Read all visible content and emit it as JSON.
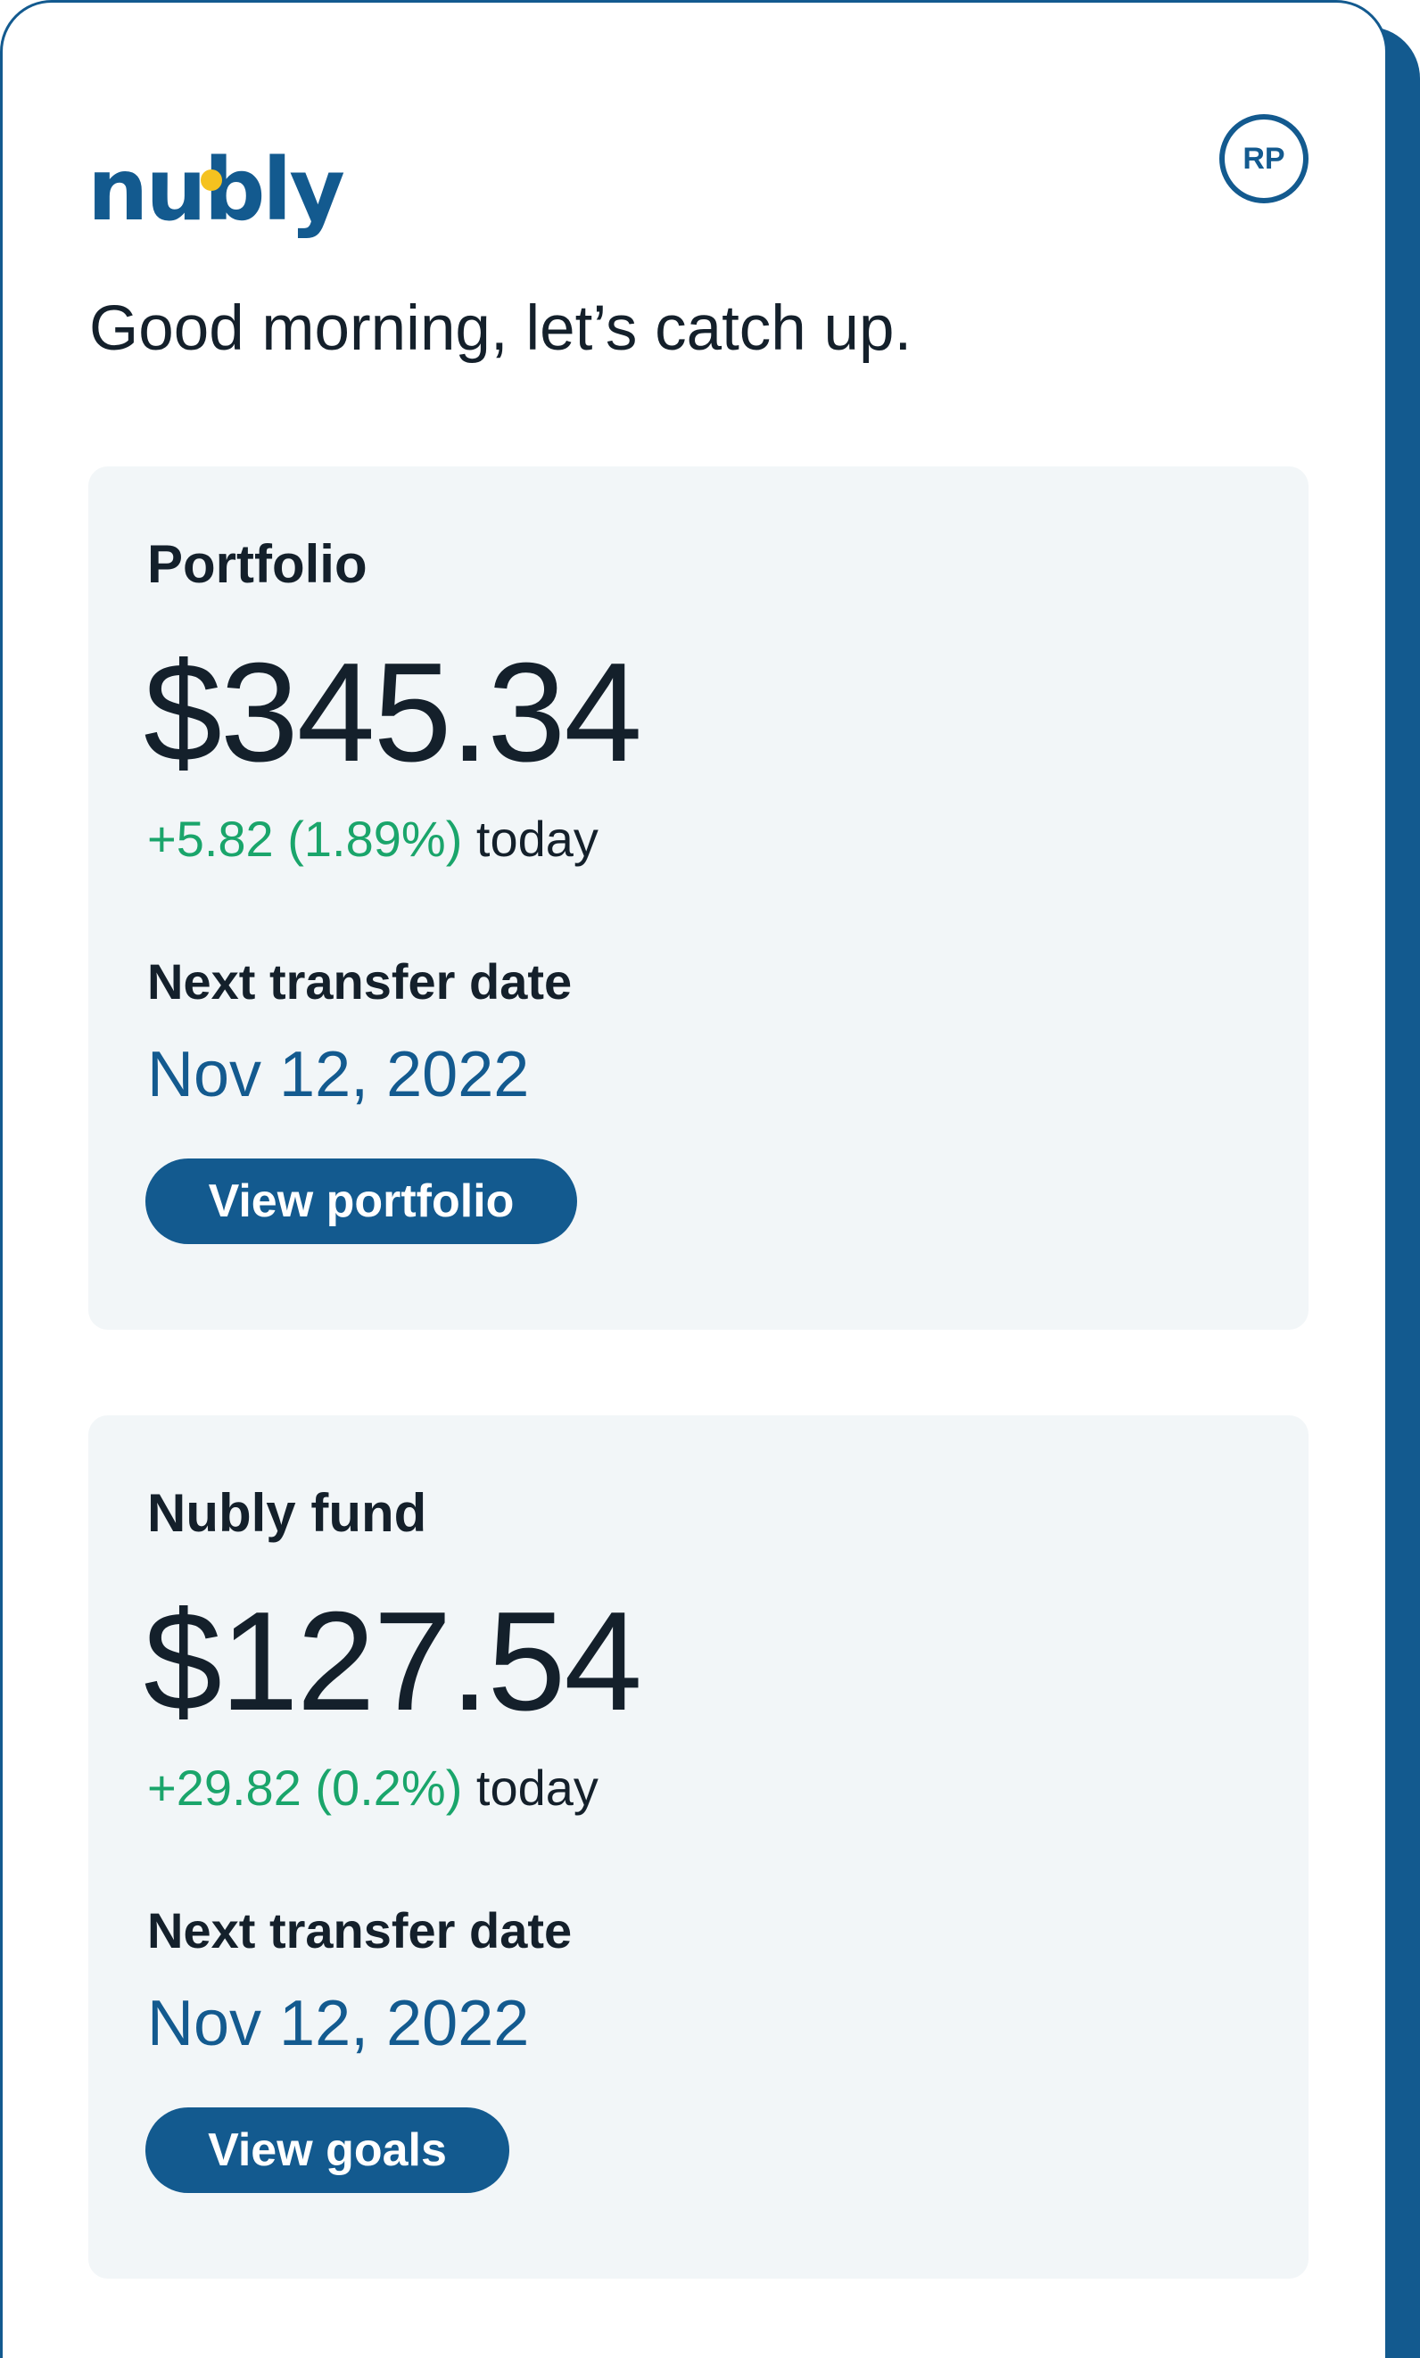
{
  "header": {
    "logo_text": "nubly",
    "avatar_initials": "RP"
  },
  "greeting": "Good morning, let’s catch up.",
  "cards": [
    {
      "title": "Portfolio",
      "amount": "$345.34",
      "change": "+5.82 (1.89%)",
      "change_suffix": "today",
      "transfer_label": "Next transfer date",
      "transfer_date": "Nov 12, 2022",
      "button_label": "View portfolio"
    },
    {
      "title": "Nubly fund",
      "amount": "$127.54",
      "change": "+29.82 (0.2%)",
      "change_suffix": "today",
      "transfer_label": "Next transfer date",
      "transfer_date": "Nov 12, 2022",
      "button_label": "View goals"
    }
  ],
  "colors": {
    "brand": "#135a8f",
    "accent_dot": "#f5c21f",
    "positive": "#1aa56b",
    "card_bg": "#f2f6f8",
    "text": "#14202b"
  }
}
